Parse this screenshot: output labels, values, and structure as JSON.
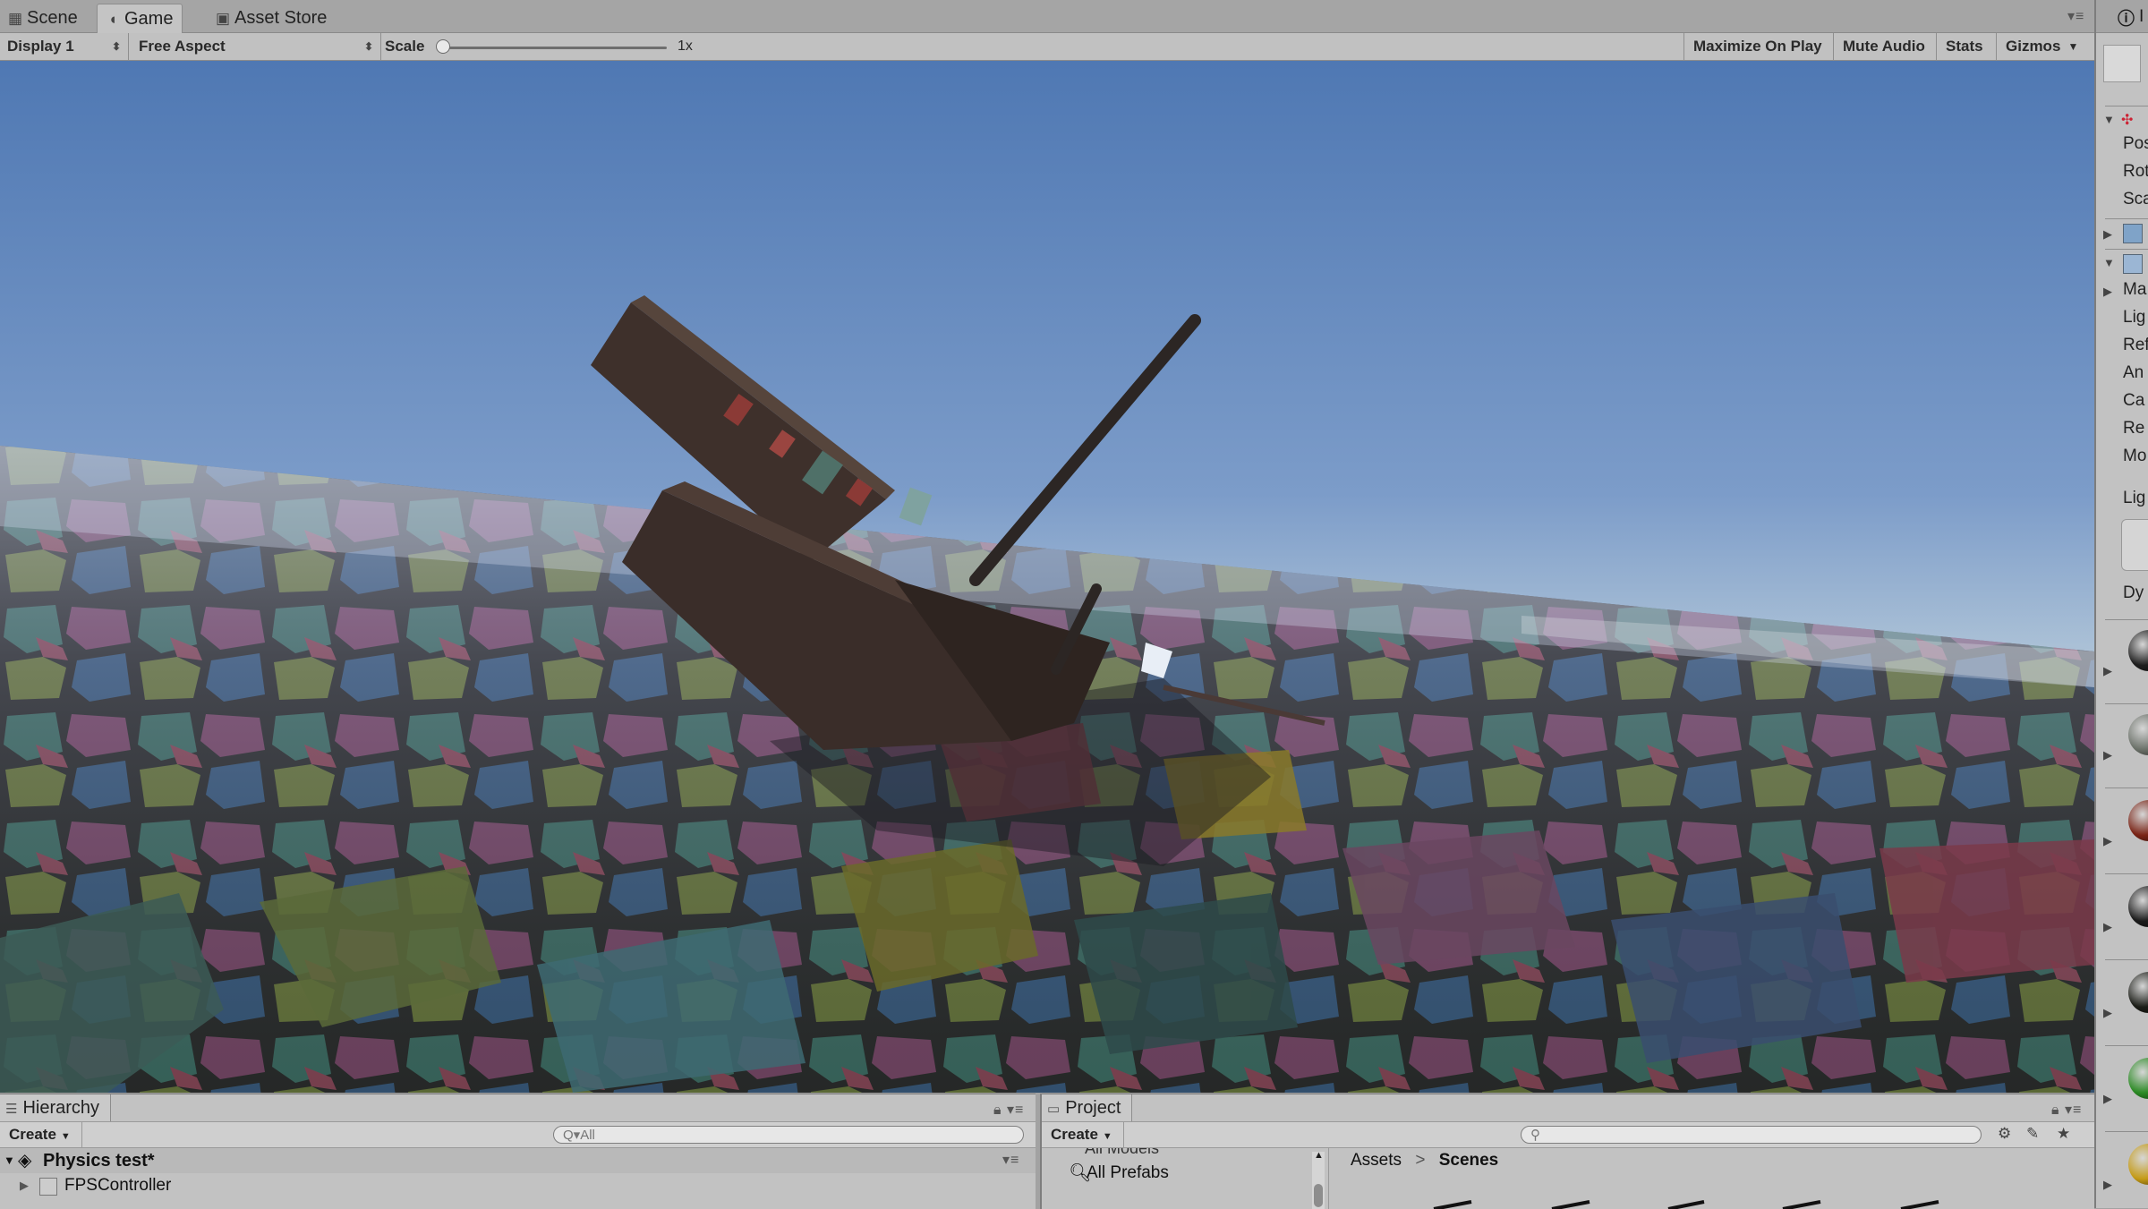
{
  "tabs": [
    {
      "label": "Scene",
      "icon": "scene-grid-icon"
    },
    {
      "label": "Game",
      "icon": "game-pacman-icon"
    },
    {
      "label": "Asset Store",
      "icon": "asset-store-bag-icon"
    }
  ],
  "game_toolbar": {
    "display": "Display 1",
    "aspect": "Free Aspect",
    "scale_label": "Scale",
    "scale_value": "1x",
    "scale_fraction": 0.0,
    "maximize_on_play": "Maximize On Play",
    "mute_audio": "Mute Audio",
    "stats": "Stats",
    "gizmos": "Gizmos"
  },
  "inspector": {
    "title_partial": "I",
    "transform_rows": [
      "Pos",
      "Rot",
      "Sca"
    ],
    "component_rows": [
      "Ma",
      "Lig",
      "Ref",
      "An",
      "Ca",
      "Re",
      "Mo"
    ],
    "lighting_label": "Lig",
    "dynamic_label": "Dy",
    "material_colors": [
      "#1f1f1f",
      "#6d736b",
      "#7a2416",
      "#1b1b1b",
      "#1c1e18",
      "#2b8a24",
      "#c59b17"
    ]
  },
  "hierarchy": {
    "tab_label": "Hierarchy",
    "create_label": "Create",
    "search_placeholder": "Q▾All",
    "scene_name": "Physics test*",
    "items": [
      "FPSController"
    ]
  },
  "project": {
    "tab_label": "Project",
    "create_label": "Create",
    "search_placeholder": "",
    "favorites_partial": "All Models",
    "favorites": [
      "All Prefabs"
    ],
    "breadcrumb": [
      "Assets",
      "Scenes"
    ]
  }
}
